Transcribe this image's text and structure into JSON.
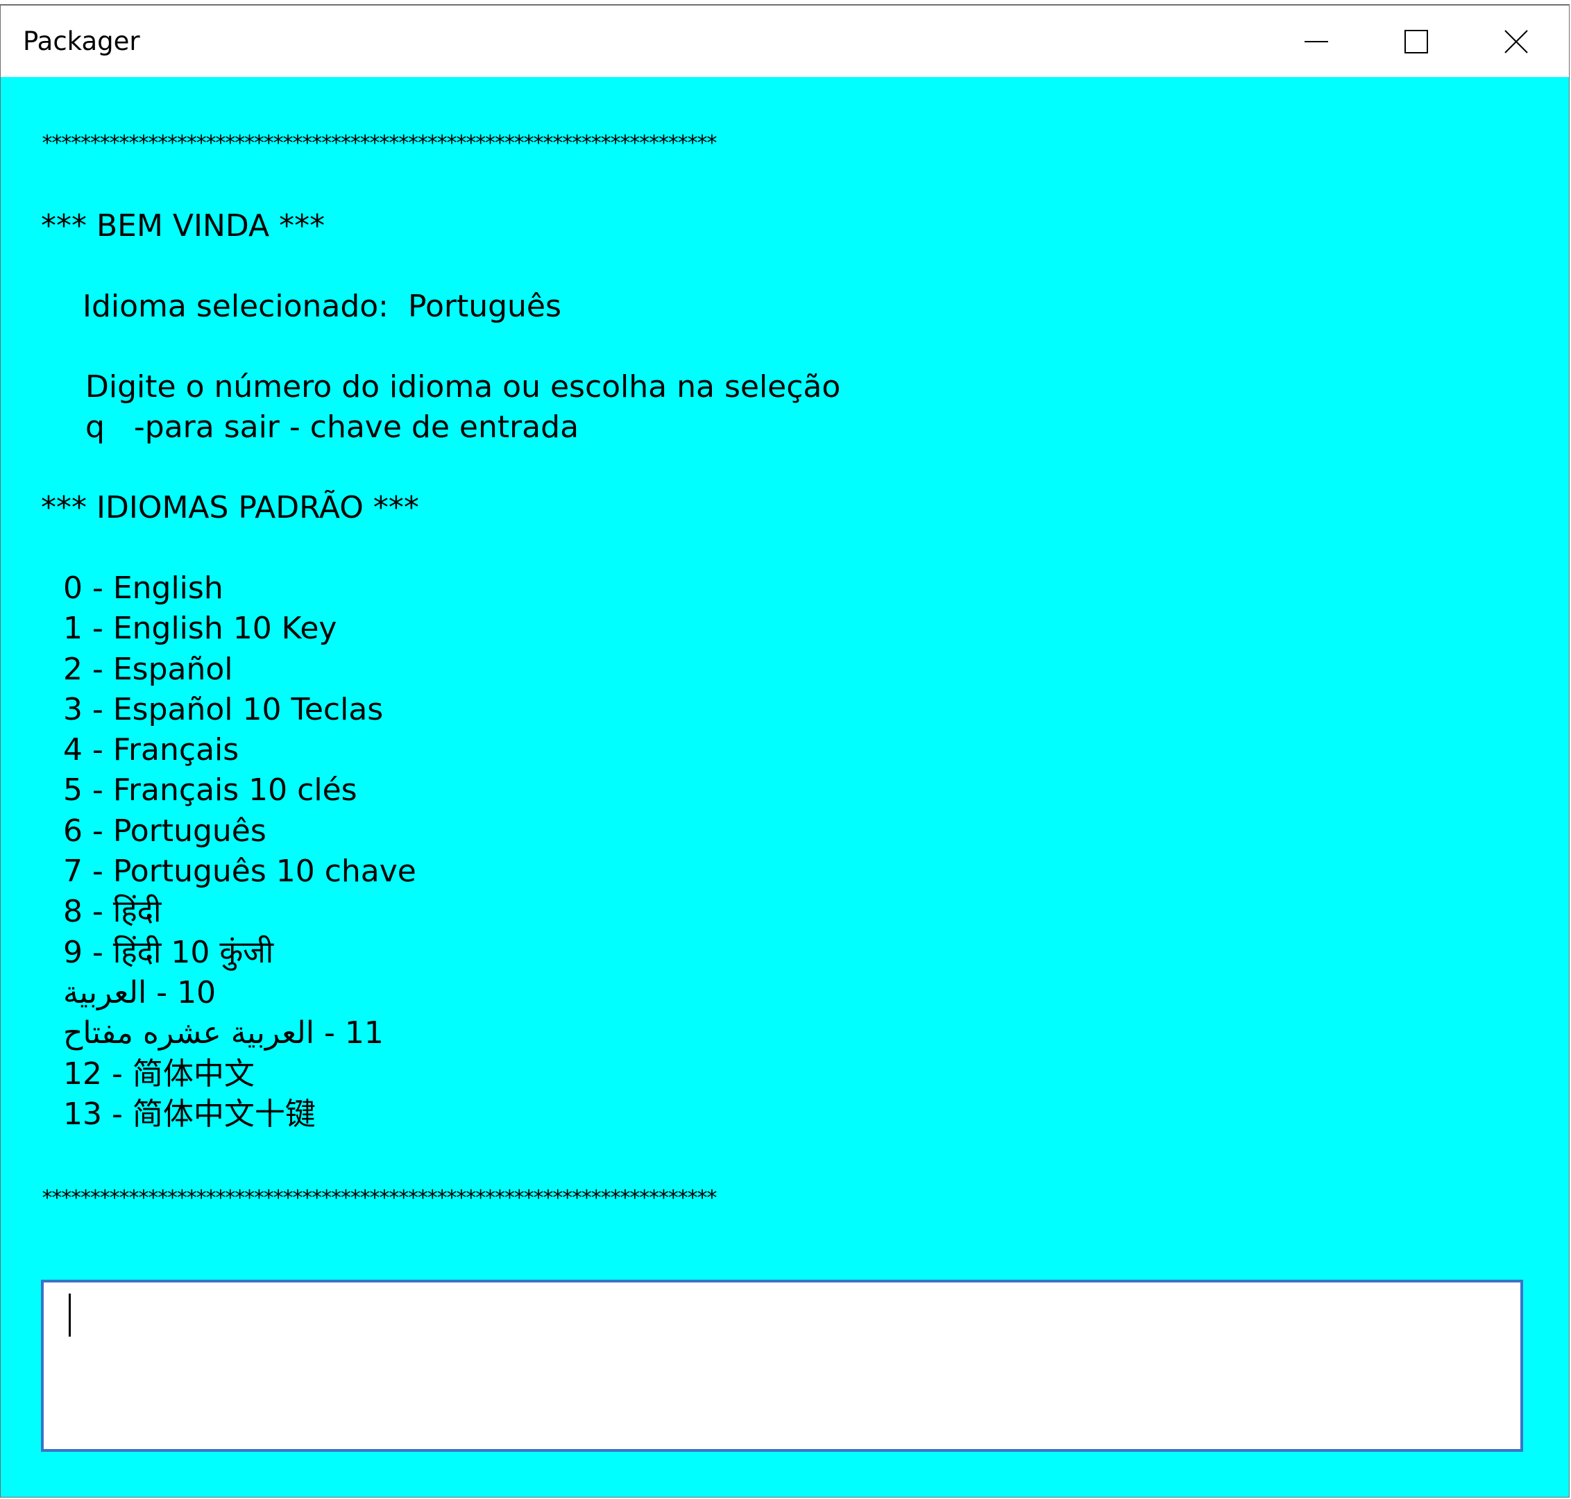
{
  "window": {
    "title": "Packager",
    "background_color": "#00ffff",
    "controls": {
      "minimize_icon": "minimize-icon",
      "maximize_icon": "maximize-icon",
      "close_icon": "close-icon"
    }
  },
  "console": {
    "separator": "**********************************************************************",
    "welcome": "*** BEM VINDA ***",
    "selected_label": "Idioma selecionado:",
    "selected_value": "Português",
    "instruction_1": "Digite o número do idioma ou escolha na seleção",
    "instruction_2": "q   -para sair - chave de entrada",
    "standard_heading": "*** IDIOMAS PADRÃO ***",
    "languages": [
      "0 - English",
      "1 - English 10 Key",
      "2 - Español",
      "3 - Español 10 Teclas",
      "4 - Français",
      "5 - Français 10 clés",
      "6 - Português",
      "7 - Português 10 chave",
      "8 - हिंदी",
      "9 - हिंदी 10 कुंजी",
      "10 - العربية",
      "11 - العربية عشره مفتاح",
      "12 - 简体中文",
      "13 - 简体中文十键"
    ]
  },
  "input": {
    "value": "",
    "border_color": "#3b74c6"
  }
}
